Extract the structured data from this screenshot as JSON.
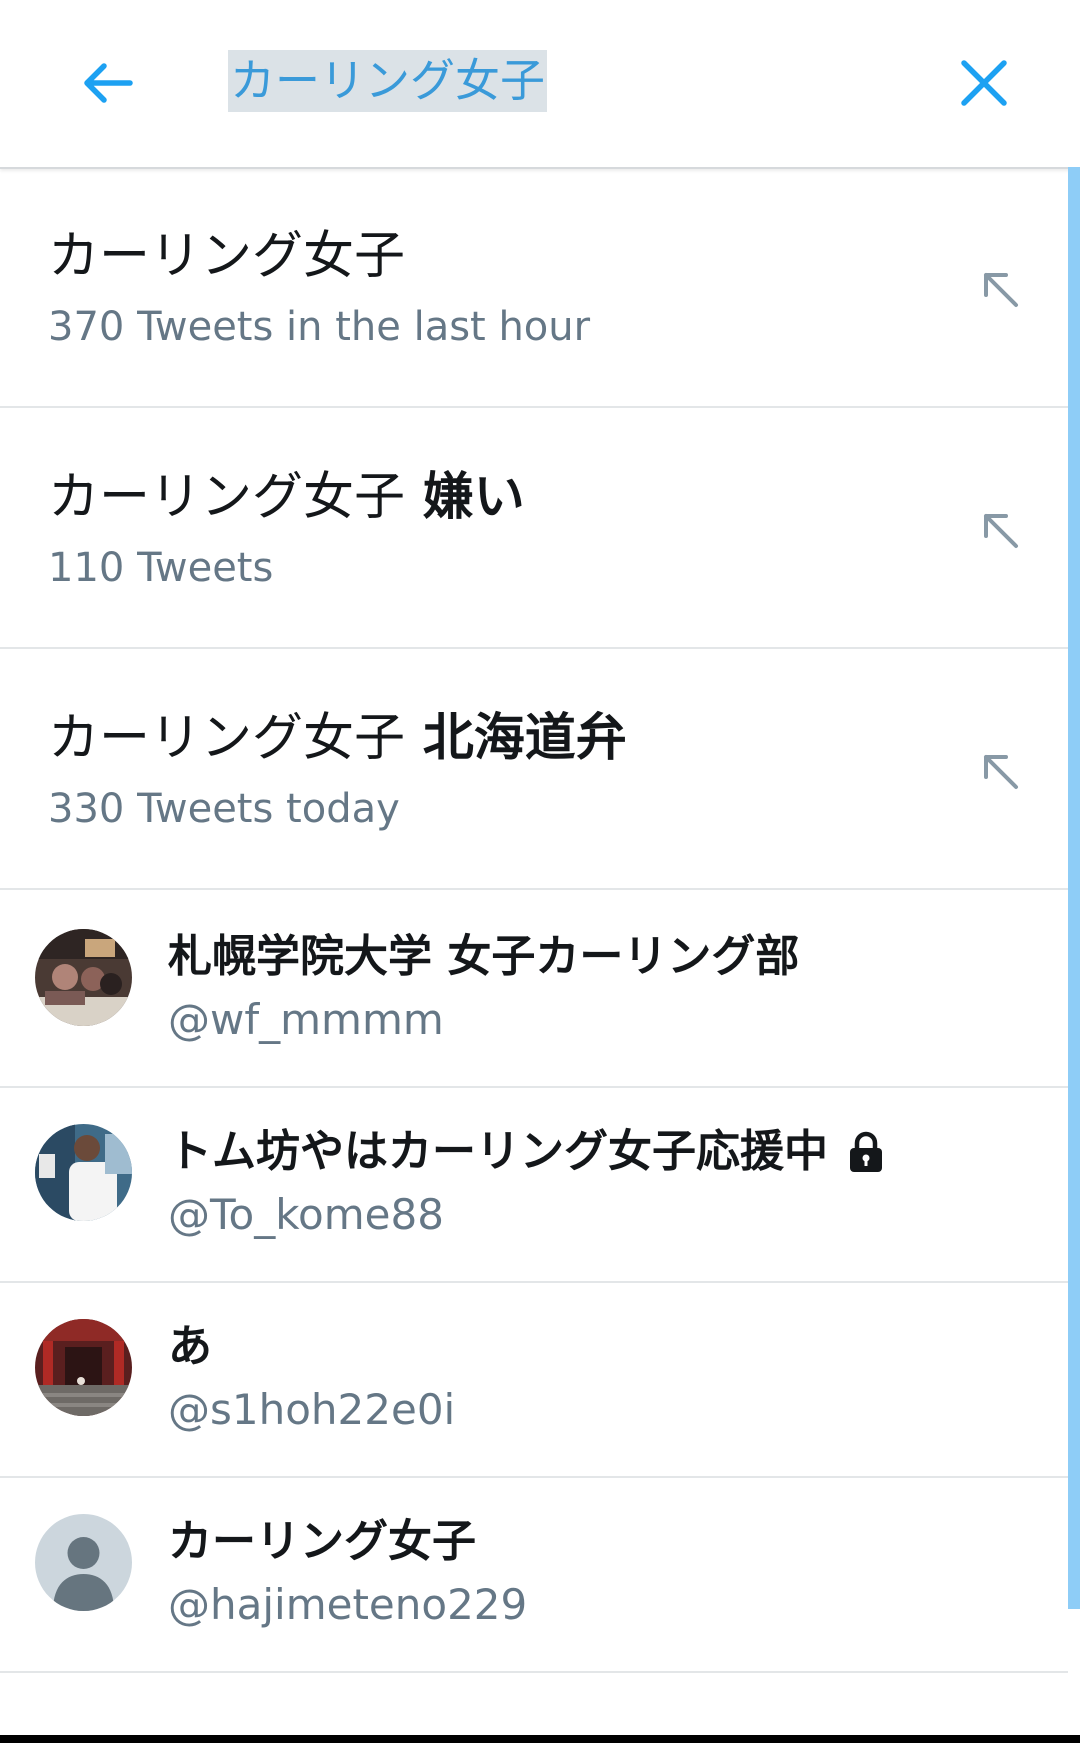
{
  "search": {
    "query": "カーリング女子",
    "back_icon": "arrow-left-icon",
    "clear_icon": "close-icon",
    "accent_color": "#1da1f2"
  },
  "suggestions": [
    {
      "base": "カーリング女子",
      "extra": "",
      "meta": "370 Tweets in the last hour",
      "icon": "arrow-up-left-icon"
    },
    {
      "base": "カーリング女子",
      "extra": " 嫌い",
      "meta": "110 Tweets",
      "icon": "arrow-up-left-icon"
    },
    {
      "base": "カーリング女子",
      "extra": " 北海道弁",
      "meta": "330 Tweets today",
      "icon": "arrow-up-left-icon"
    }
  ],
  "users": [
    {
      "name": "札幌学院大学 女子カーリング部",
      "handle": "@wf_mmmm",
      "protected": false,
      "avatar": "group-photo-avatar"
    },
    {
      "name": "トム坊やはカーリング女子応援中",
      "handle": "@To_kome88",
      "protected": true,
      "avatar": "athlete-photo-avatar"
    },
    {
      "name": "あ",
      "handle": "@s1hoh22e0i",
      "protected": false,
      "avatar": "shrine-photo-avatar"
    },
    {
      "name": "カーリング女子",
      "handle": "@hajimeteno229",
      "protected": false,
      "avatar": "default-profile-avatar"
    }
  ],
  "colors": {
    "secondary_text": "#657786",
    "primary_text": "#14171a",
    "divider": "#e3e6e8",
    "scroll_indicator": "#8ecdf7",
    "query_highlight": "#dbe2e7"
  }
}
